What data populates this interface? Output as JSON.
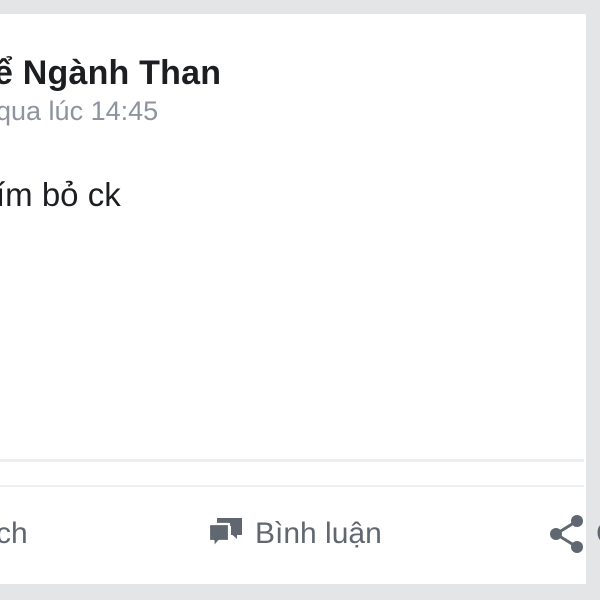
{
  "post": {
    "author": "ể Ngành Than",
    "time": "qua lúc 14:45",
    "text": "ím bỏ ck"
  },
  "actions": {
    "like_label": "ch",
    "comment_label": "Bình luận",
    "share_label": "C"
  },
  "colors": {
    "background": "#e4e5e7",
    "card": "#ffffff",
    "primary_text": "#1c1e21",
    "secondary_text": "#8d949e",
    "action_text": "#606770"
  },
  "icons": {
    "comment": "comment-icon",
    "share": "share-icon"
  }
}
